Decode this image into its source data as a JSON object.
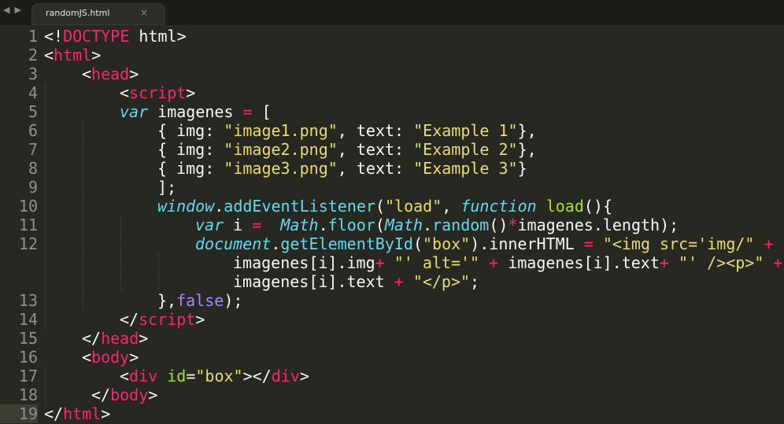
{
  "tabbar": {
    "back_icon": "◀",
    "forward_icon": "▶",
    "tab": {
      "title": "randomJS.html",
      "close_icon": "×"
    }
  },
  "editor": {
    "current_line": 19,
    "colors": {
      "background": "#272822",
      "tag": "#f92672",
      "string": "#e6db74",
      "storage": "#66d9ef",
      "function": "#a6e22e",
      "constant": "#ae81ff",
      "text": "#f8f8f2",
      "gutter": "#8f908a"
    },
    "lines": [
      {
        "num": "1",
        "indent": 0,
        "tokens": [
          [
            "punc",
            "<!"
          ],
          [
            "doctype",
            "DOCTYPE"
          ],
          [
            "punc",
            " html>"
          ]
        ]
      },
      {
        "num": "2",
        "indent": 0,
        "tokens": [
          [
            "punc",
            "<"
          ],
          [
            "tag",
            "html"
          ],
          [
            "punc",
            ">"
          ]
        ]
      },
      {
        "num": "3",
        "indent": 4,
        "tokens": [
          [
            "punc",
            "<"
          ],
          [
            "tag",
            "head"
          ],
          [
            "punc",
            ">"
          ]
        ]
      },
      {
        "num": "4",
        "indent": 8,
        "tokens": [
          [
            "punc",
            "<"
          ],
          [
            "tag",
            "script"
          ],
          [
            "punc",
            ">"
          ]
        ]
      },
      {
        "num": "5",
        "indent": 8,
        "tokens": [
          [
            "stor",
            "var"
          ],
          [
            "punc",
            " imagenes "
          ],
          [
            "kw",
            "="
          ],
          [
            "punc",
            " ["
          ]
        ]
      },
      {
        "num": "6",
        "indent": 12,
        "tokens": [
          [
            "punc",
            "{ img: "
          ],
          [
            "str",
            "\"image1.png\""
          ],
          [
            "punc",
            ", text: "
          ],
          [
            "str",
            "\"Example 1\""
          ],
          [
            "punc",
            "},"
          ]
        ]
      },
      {
        "num": "7",
        "indent": 12,
        "tokens": [
          [
            "punc",
            "{ img: "
          ],
          [
            "str",
            "\"image2.png\""
          ],
          [
            "punc",
            ", text: "
          ],
          [
            "str",
            "\"Example 2\""
          ],
          [
            "punc",
            "},"
          ]
        ]
      },
      {
        "num": "8",
        "indent": 12,
        "tokens": [
          [
            "punc",
            "{ img: "
          ],
          [
            "str",
            "\"image3.png\""
          ],
          [
            "punc",
            ", text: "
          ],
          [
            "str",
            "\"Example 3\""
          ],
          [
            "punc",
            "}"
          ]
        ]
      },
      {
        "num": "9",
        "indent": 12,
        "tokens": [
          [
            "punc",
            "];"
          ]
        ]
      },
      {
        "num": "10",
        "indent": 12,
        "tokens": [
          [
            "support",
            "window"
          ],
          [
            "punc",
            "."
          ],
          [
            "method",
            "addEventListener"
          ],
          [
            "punc",
            "("
          ],
          [
            "str",
            "\"load\""
          ],
          [
            "punc",
            ", "
          ],
          [
            "stor",
            "function"
          ],
          [
            "punc",
            " "
          ],
          [
            "func",
            "load"
          ],
          [
            "punc",
            "(){"
          ]
        ]
      },
      {
        "num": "11",
        "indent": 16,
        "tokens": [
          [
            "stor",
            "var"
          ],
          [
            "punc",
            " i "
          ],
          [
            "kw",
            "="
          ],
          [
            "punc",
            "  "
          ],
          [
            "support",
            "Math"
          ],
          [
            "punc",
            "."
          ],
          [
            "method",
            "floor"
          ],
          [
            "punc",
            "("
          ],
          [
            "support",
            "Math"
          ],
          [
            "punc",
            "."
          ],
          [
            "method",
            "random"
          ],
          [
            "punc",
            "()"
          ],
          [
            "kw",
            "*"
          ],
          [
            "punc",
            "imagenes.length);"
          ]
        ]
      },
      {
        "num": "12",
        "indent": 16,
        "tokens": [
          [
            "support",
            "document"
          ],
          [
            "punc",
            "."
          ],
          [
            "method",
            "getElementById"
          ],
          [
            "punc",
            "("
          ],
          [
            "str",
            "\"box\""
          ],
          [
            "punc",
            ").innerHTML "
          ],
          [
            "kw",
            "="
          ],
          [
            "punc",
            " "
          ],
          [
            "str",
            "\"<img src='img/\""
          ],
          [
            "punc",
            " "
          ],
          [
            "kw",
            "+"
          ]
        ]
      },
      {
        "num": "",
        "indent": 20,
        "tokens": [
          [
            "punc",
            "imagenes[i].img"
          ],
          [
            "kw",
            "+"
          ],
          [
            "punc",
            " "
          ],
          [
            "str",
            "\"' alt='\""
          ],
          [
            "punc",
            " "
          ],
          [
            "kw",
            "+"
          ],
          [
            "punc",
            " imagenes[i].text"
          ],
          [
            "kw",
            "+"
          ],
          [
            "punc",
            " "
          ],
          [
            "str",
            "\"' /><p>\""
          ],
          [
            "punc",
            " "
          ],
          [
            "kw",
            "+"
          ]
        ]
      },
      {
        "num": "",
        "indent": 20,
        "tokens": [
          [
            "punc",
            "imagenes[i].text "
          ],
          [
            "kw",
            "+"
          ],
          [
            "punc",
            " "
          ],
          [
            "str",
            "\"</p>\""
          ],
          [
            "punc",
            ";"
          ]
        ]
      },
      {
        "num": "13",
        "indent": 12,
        "tokens": [
          [
            "punc",
            "},"
          ],
          [
            "const",
            "false"
          ],
          [
            "punc",
            ");"
          ]
        ]
      },
      {
        "num": "14",
        "indent": 8,
        "tokens": [
          [
            "punc",
            "</"
          ],
          [
            "tag",
            "script"
          ],
          [
            "punc",
            ">"
          ]
        ]
      },
      {
        "num": "15",
        "indent": 4,
        "tokens": [
          [
            "punc",
            "</"
          ],
          [
            "tag",
            "head"
          ],
          [
            "punc",
            ">"
          ]
        ]
      },
      {
        "num": "16",
        "indent": 4,
        "tokens": [
          [
            "punc",
            "<"
          ],
          [
            "tag",
            "body"
          ],
          [
            "punc",
            ">"
          ]
        ]
      },
      {
        "num": "17",
        "indent": 8,
        "tokens": [
          [
            "punc",
            "<"
          ],
          [
            "tag",
            "div"
          ],
          [
            "punc",
            " "
          ],
          [
            "attr",
            "id"
          ],
          [
            "punc",
            "="
          ],
          [
            "str",
            "\"box\""
          ],
          [
            "punc",
            "></"
          ],
          [
            "tag",
            "div"
          ],
          [
            "punc",
            ">"
          ]
        ]
      },
      {
        "num": "18",
        "indent": 5,
        "tokens": [
          [
            "punc",
            "</"
          ],
          [
            "tag",
            "body"
          ],
          [
            "punc",
            ">"
          ]
        ]
      },
      {
        "num": "19",
        "indent": 0,
        "tokens": [
          [
            "punc",
            "</"
          ],
          [
            "tag",
            "html"
          ],
          [
            "punc",
            ">"
          ]
        ]
      }
    ]
  }
}
